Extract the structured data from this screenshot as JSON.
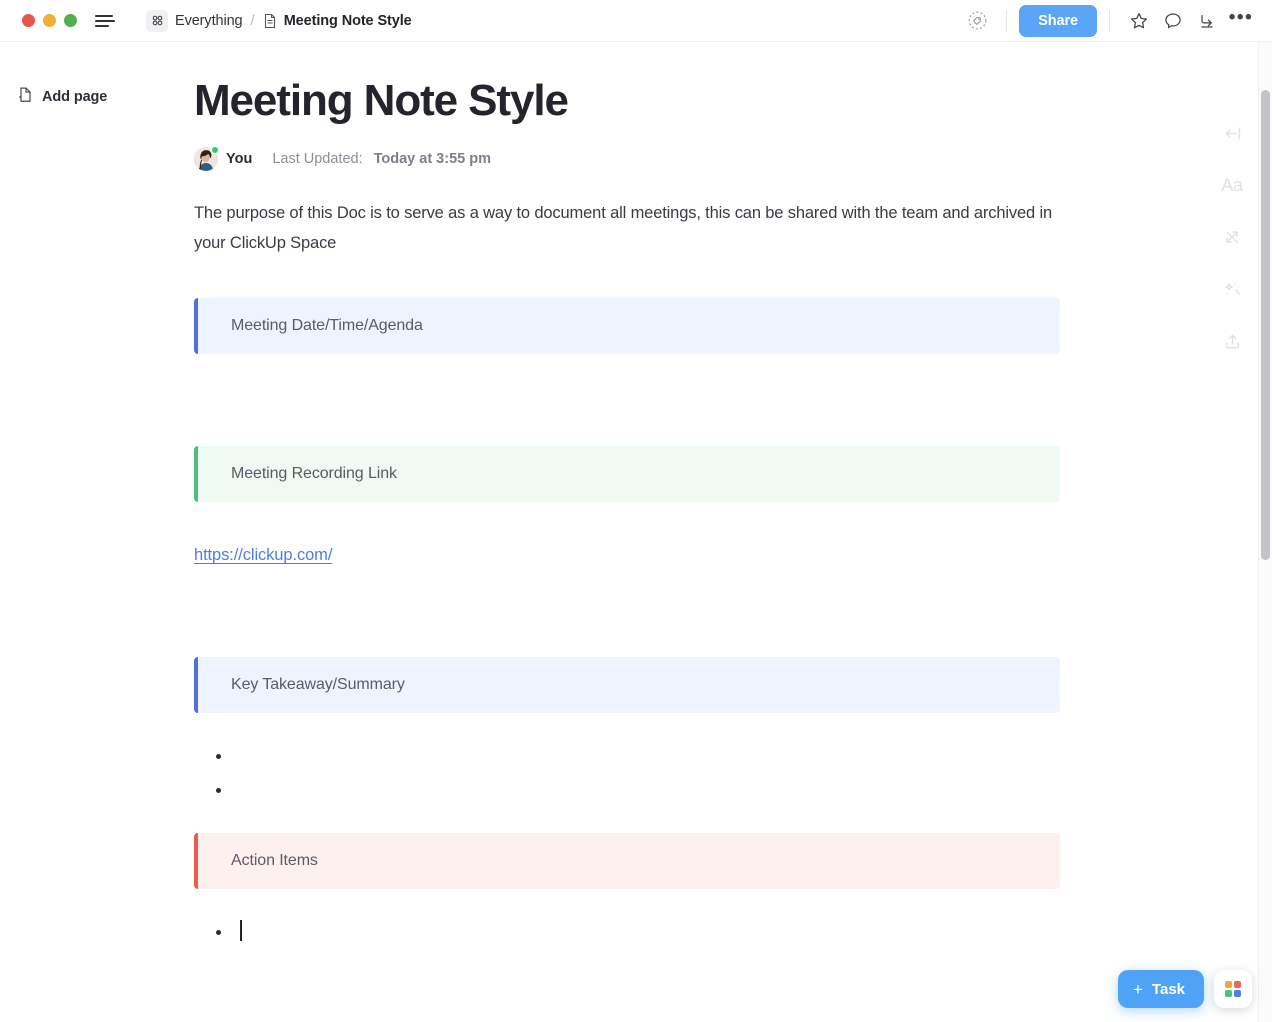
{
  "window": {
    "traffic_lights": [
      "close",
      "minimize",
      "zoom"
    ],
    "menu_icon": "hamburger-icon"
  },
  "topbar": {
    "breadcrumb": {
      "root_icon": "everything-grid-icon",
      "root_label": "Everything",
      "separator": "/",
      "doc_icon": "document-icon",
      "current_label": "Meeting Note Style"
    },
    "tag_icon": "tag-icon",
    "share_label": "Share",
    "star_icon": "star-icon",
    "comment_icon": "comment-bubble-icon",
    "download_icon": "download-icon",
    "more_icon": "more-options-icon",
    "more_glyph": "•••",
    "accent_color": "#5aa5f7"
  },
  "sidebar": {
    "add_page_icon": "add-page-icon",
    "add_page_label": "Add page"
  },
  "document": {
    "title": "Meeting Note Style",
    "author": "You",
    "updated_label": "Last Updated:",
    "updated_value": "Today at 3:55 pm",
    "intro_paragraph": "The purpose of this Doc is to serve as a way to document all meetings, this can be shared with the team and archived in your ClickUp Space",
    "callouts": [
      {
        "label": "Meeting Date/Time/Agenda",
        "color": "#4d6fe0",
        "bg": "#eef3fe",
        "variant": "blue"
      },
      {
        "label": "Meeting Recording Link",
        "color": "#4cc07b",
        "bg": "#eefaf2",
        "variant": "green"
      },
      {
        "label": "Key Takeaway/Summary",
        "color": "#4d6fe0",
        "bg": "#eef3fe",
        "variant": "blue"
      },
      {
        "label": "Action Items",
        "color": "#ef5a4c",
        "bg": "#fdf1ef",
        "variant": "red"
      }
    ],
    "recording_link": "https://clickup.com/",
    "summary_bullets": [
      "",
      ""
    ],
    "action_bullets": [
      ""
    ]
  },
  "right_rail": {
    "items": [
      {
        "icon": "collapse-left-icon"
      },
      {
        "icon": "font-size-aa-icon",
        "label": "Aa"
      },
      {
        "icon": "relationships-arrows-icon"
      },
      {
        "icon": "ai-sparkle-wand-icon"
      },
      {
        "icon": "export-upload-icon"
      }
    ]
  },
  "floating": {
    "task_plus": "+",
    "task_label": "Task",
    "apps_icon": "apps-launcher-icon",
    "apps_colors": [
      "#f0a63c",
      "#e8655c",
      "#4cc07b",
      "#4a7fe8"
    ]
  },
  "scrollbar": {
    "orientation": "vertical"
  }
}
